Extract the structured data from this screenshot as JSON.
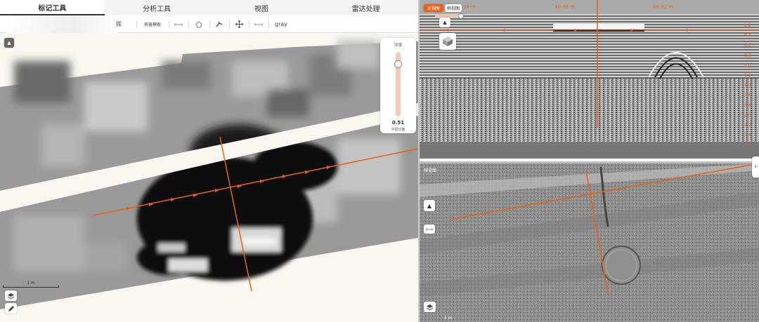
{
  "tabs": [
    "标记工具",
    "分析工具",
    "视图",
    "雷达处理"
  ],
  "toolbar": {
    "left_text": "挥",
    "template_btn": "病害模板",
    "colormap": "gray",
    "icons": [
      "ruler-icon",
      "polygon-icon",
      "pointer-icon",
      "move-icon",
      "measure-icon"
    ]
  },
  "depth_control": {
    "title": "深度",
    "value": "0.51",
    "unit": "中間切面"
  },
  "left_scale": "1 m",
  "right_top": {
    "btn_front": "正視图",
    "btn_side": "侧视图",
    "top_labels": [
      "24 m",
      "40.08 m",
      "49.92 m"
    ],
    "depth_labels": [
      "0.2",
      "0.4",
      "0.6",
      "0.8",
      "1.0",
      "1.2",
      "1.4",
      "1.6",
      "1.8",
      "2.0",
      "2.2",
      "2.4",
      "2.6",
      "2.8",
      "3.0"
    ]
  },
  "right_bottom": {
    "label": "预览图",
    "scale": "1 m"
  },
  "colors": {
    "accent": "#e8601c",
    "active_btn": "#e8601c"
  }
}
